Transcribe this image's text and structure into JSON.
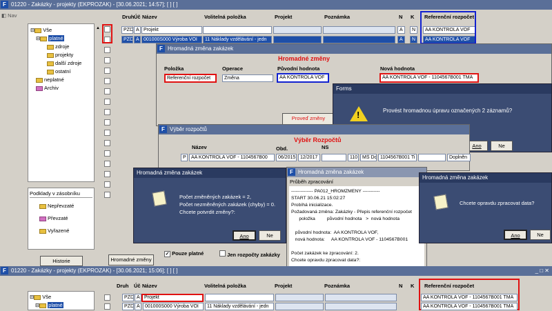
{
  "main": {
    "title": "01220 - Zakázky - projekty (EKPROZAK) - [30.06.2021; 14:57]; [ ] [ ]",
    "nav": "Nav",
    "columns": {
      "druh": "Druh",
      "uc": "Úč",
      "nazev": "Název",
      "volitelna": "Volitelná položka",
      "projekt": "Projekt",
      "poznamka": "Poznámka",
      "n": "N",
      "k": "K",
      "ref": "Referenční rozpočet"
    },
    "rows": [
      {
        "druh": "PZD",
        "uc": "A",
        "nazev": "Projekt",
        "volitelna": "",
        "n": "A",
        "k": "N",
        "ref": "AA KONTROLA VOF"
      },
      {
        "druh": "PZD",
        "uc": "A",
        "nazev": "001000S000 Výroba VOI",
        "volitelna": "11 Náklady vzdělávání - jedn",
        "n": "A",
        "k": "N",
        "ref": "AA KONTROLA VOF"
      }
    ],
    "tree": {
      "root": "Vše",
      "platne": "platné",
      "zdroje": "zdroje",
      "projekty": "projekty",
      "dalsi_zdroje": "další zdroje",
      "ostatni": "ostatní",
      "neplatne": "neplatné",
      "archiv": "Archiv"
    },
    "podklady": {
      "title": "Podklady v zásobníku",
      "nepr": "Nepřevzaté",
      "prev": "Převzaté",
      "vyr": "Vyřazené"
    },
    "historie": "Historie",
    "hromadne_btn": "Hromadné změny",
    "pouze_platne": "Pouze platné",
    "jen_rozpocty": "Jen rozpočty zakázky"
  },
  "hz": {
    "title": "Hromadná změna zakázek",
    "heading": "Hromadné změny",
    "col_polozka": "Položka",
    "col_operace": "Operace",
    "col_puvodni": "Původní hodnota",
    "col_nova": "Nová hodnota",
    "polozka": "Referenční rozpočet",
    "operace": "Změna",
    "puvodni": "AA KONTROLA VOF",
    "nova": "AA KONTROLA VOF - 1104567B001 TMA",
    "proved": "Proveď změny"
  },
  "forms": {
    "title": "Forms",
    "msg": "Provést hromadnou úpravu označených 2 záznamů?",
    "ano": "Ano",
    "ne": "Ne"
  },
  "vr": {
    "title": "Výběr rozpočtů",
    "heading": "Výběr Rozpočtů",
    "col_nazev": "Název",
    "col_obd": "Obd.",
    "col_ns": "NS",
    "row": {
      "p": "P",
      "nazev": "AA KONTROLA VOF - 1104567B00",
      "od": "06/2015",
      "do": "12/2017",
      "num": "110",
      "ms": "MŠ Do",
      "ref": "1104567B001 Ti",
      "dopl": "Doplněn"
    }
  },
  "hz2": {
    "title": "Hromadná změna zakázek",
    "l1": "Počet změněných zakázek = 2,",
    "l2": "Počet nezměněných zakázek (chyby) = 0.",
    "l3": "Chcete potvrdit změny?:",
    "ano": "Ano",
    "ne": "Ne"
  },
  "log": {
    "title": "Hromadná změna zakázek",
    "sub": "Průběh zpracování",
    "lines": [
      "-------------- PA012_HROMZMENY -----------",
      "START 30.06.21 15:02:27",
      "Probíhá inicializace.",
      "Požadovaná změna: Zakázky - Přepis referenční rozpočet",
      "      položka         původní hodnota   >  nová hodnota",
      "",
      "   původní hodnota:  AA KONTROLA VOF,",
      "   nová hodnota:     AA KONTROLA VOF - 1104567B001",
      "",
      "Počet zakázek ke zpracování: 2.",
      "Chcete opravdu zpracovat data?:"
    ]
  },
  "hz3": {
    "title": "Hromadná změna zakázek",
    "msg": "Chcete opravdu zpracovat data?",
    "ano": "Ano",
    "ne": "Ne"
  },
  "bottom": {
    "title": "01220 - Zakázky - projekty (EKPROZAK) - [30.06.2021; 15:06]; [ ] [ ]",
    "rows": [
      {
        "druh": "PZD",
        "uc": "A",
        "nazev": "Projekt",
        "volitelna": "",
        "ref": "AA KONTROLA VOF - 1104567B001 TMA"
      },
      {
        "druh": "PZD",
        "uc": "A",
        "nazev": "001000S000 Výroba VOI",
        "volitelna": "11 Náklady vzdělávání - jedn",
        "ref": "AA KONTROLA VOF - 1104567B001 TMA"
      }
    ],
    "tree": {
      "root": "Vše",
      "platne": "platné"
    },
    "win_btns": "_ □ ✕"
  }
}
